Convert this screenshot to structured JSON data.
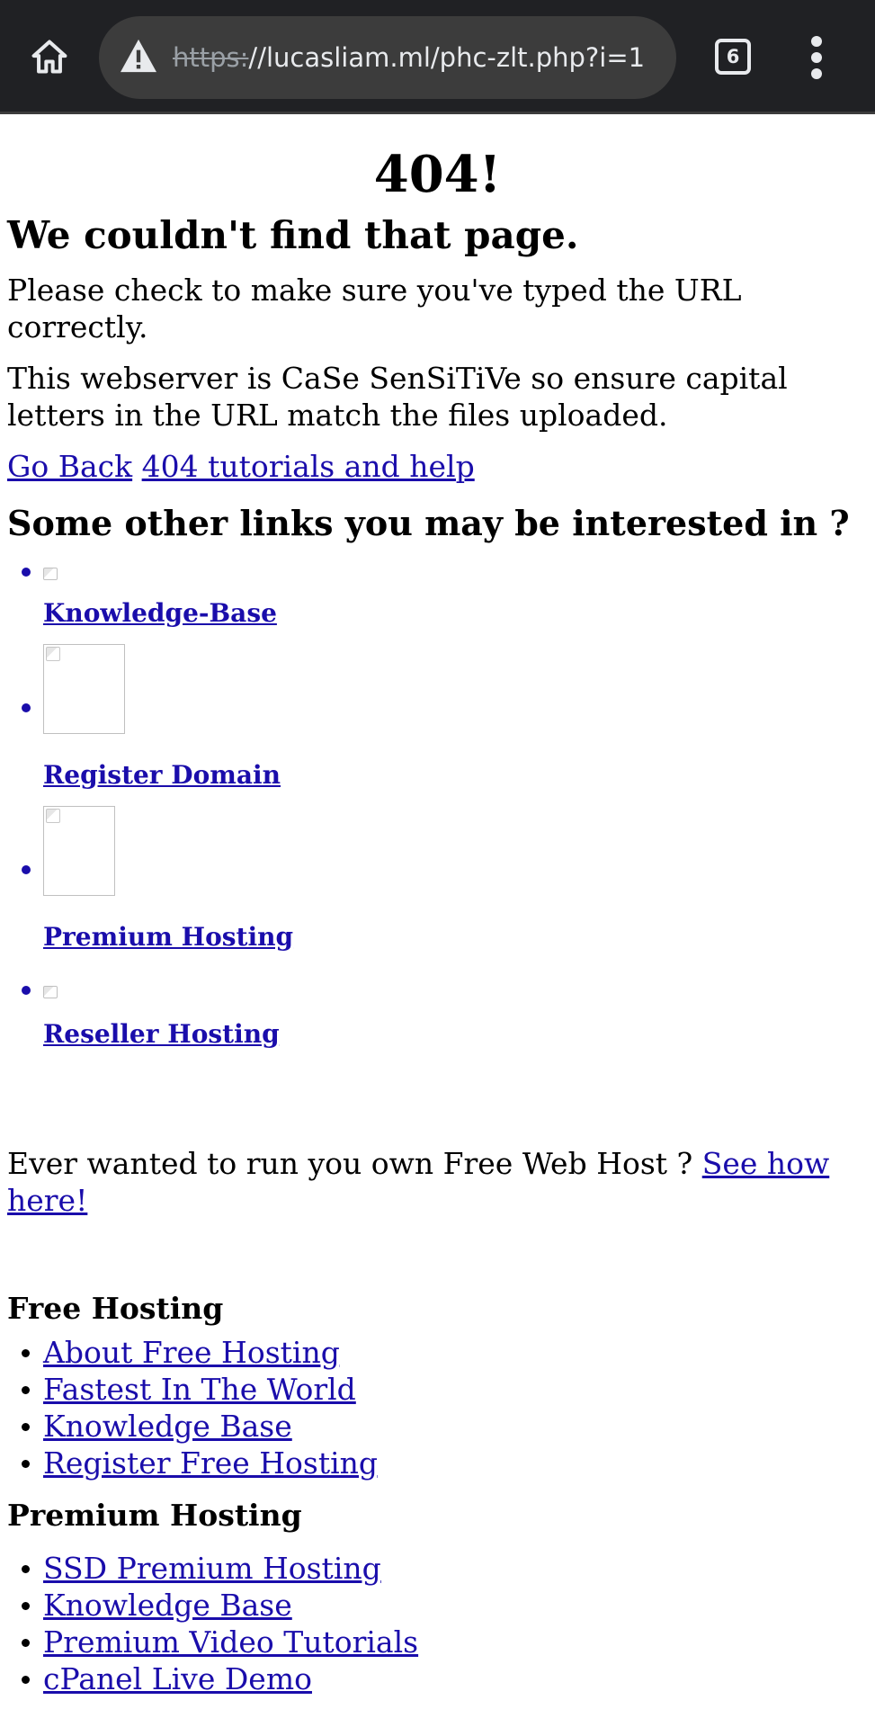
{
  "browser": {
    "url_scheme": "https:",
    "url_rest": "//lucasliam.ml/phc-zlt.php?i=1",
    "tab_count": "6",
    "icons": {
      "home": "home-icon",
      "security": "not-secure-warning-icon",
      "tabs": "tab-switcher-icon",
      "menu": "more-vert-icon"
    }
  },
  "page": {
    "code": "404!",
    "title": "We couldn't find that page.",
    "para1": "Please check to make sure you've typed the URL correctly.",
    "para2": "This webserver is CaSe SenSiTiVe so ensure capital letters in the URL match the files uploaded.",
    "link_back": "Go Back",
    "link_help": "404 tutorials and help",
    "other_links_title": "Some other links you may be interested in ?",
    "promo_items": [
      {
        "label": "Knowledge-Base"
      },
      {
        "label": "Register Domain"
      },
      {
        "label": "Premium Hosting"
      },
      {
        "label": "Reseller Hosting"
      }
    ],
    "freehost_text": "Ever wanted to run you own Free Web Host ? ",
    "freehost_link": "See how here!",
    "free_hosting": {
      "title": "Free Hosting",
      "links": [
        "About Free Hosting",
        "Fastest In The World",
        "Knowledge Base",
        "Register Free Hosting"
      ]
    },
    "premium_hosting": {
      "title": "Premium Hosting",
      "links": [
        "SSD Premium Hosting",
        "Knowledge Base",
        "Premium Video Tutorials",
        "cPanel Live Demo"
      ]
    }
  },
  "colors": {
    "toolbar_bg": "#202124",
    "omnibox_bg": "#3c3c3c",
    "link": "#1a0dab"
  }
}
